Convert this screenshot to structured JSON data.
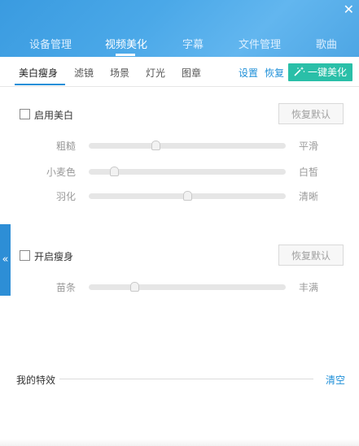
{
  "header": {
    "close_glyph": "✕",
    "tabs": [
      {
        "label": "设备管理"
      },
      {
        "label": "视频美化",
        "active": true
      },
      {
        "label": "字幕"
      },
      {
        "label": "文件管理"
      },
      {
        "label": "歌曲"
      }
    ]
  },
  "subtabs": {
    "items": [
      {
        "label": "美白瘦身",
        "active": true
      },
      {
        "label": "滤镜"
      },
      {
        "label": "场景"
      },
      {
        "label": "灯光"
      },
      {
        "label": "图章"
      }
    ],
    "settings_link": "设置",
    "restore_link": "恢复",
    "one_key_button": "一键美化"
  },
  "whitening": {
    "checkbox_label": "启用美白",
    "checked": false,
    "reset_button": "恢复默认",
    "sliders": [
      {
        "left": "粗糙",
        "right": "平滑",
        "value": 0.34
      },
      {
        "left": "小麦色",
        "right": "白皙",
        "value": 0.13
      },
      {
        "left": "羽化",
        "right": "清晰",
        "value": 0.5
      }
    ]
  },
  "slimming": {
    "checkbox_label": "开启瘦身",
    "checked": false,
    "reset_button": "恢复默认",
    "sliders": [
      {
        "left": "苗条",
        "right": "丰满",
        "value": 0.23
      }
    ]
  },
  "side_handle_glyph": "«",
  "effects": {
    "label": "我的特效",
    "clear_link": "清空"
  },
  "colors": {
    "header_blue": "#3a9be0",
    "accent_blue": "#1e8fd8",
    "one_key_green": "#2abfa8"
  }
}
